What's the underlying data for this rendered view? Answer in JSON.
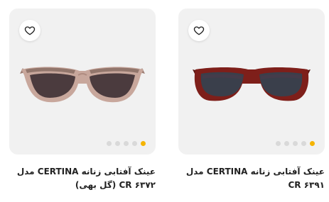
{
  "products": [
    {
      "title": "عینک آفتابی زنانه CERTINA مدل CR ۶۳۷۲ (گل بهی)",
      "colors": {
        "frame": "#c8a79c",
        "lens": "#4b3b3e"
      },
      "carousel": {
        "count": 5,
        "active_index": 4
      }
    },
    {
      "title": "عینک آفتابی زنانه CERTINA مدل CR ۶۳۹۱",
      "colors": {
        "frame": "#7e1f1a",
        "lens": "#3a3f4b"
      },
      "carousel": {
        "count": 5,
        "active_index": 4
      }
    }
  ],
  "ui": {
    "favorite_icon": "heart-outline-icon",
    "accent_color": "#f5b400"
  }
}
